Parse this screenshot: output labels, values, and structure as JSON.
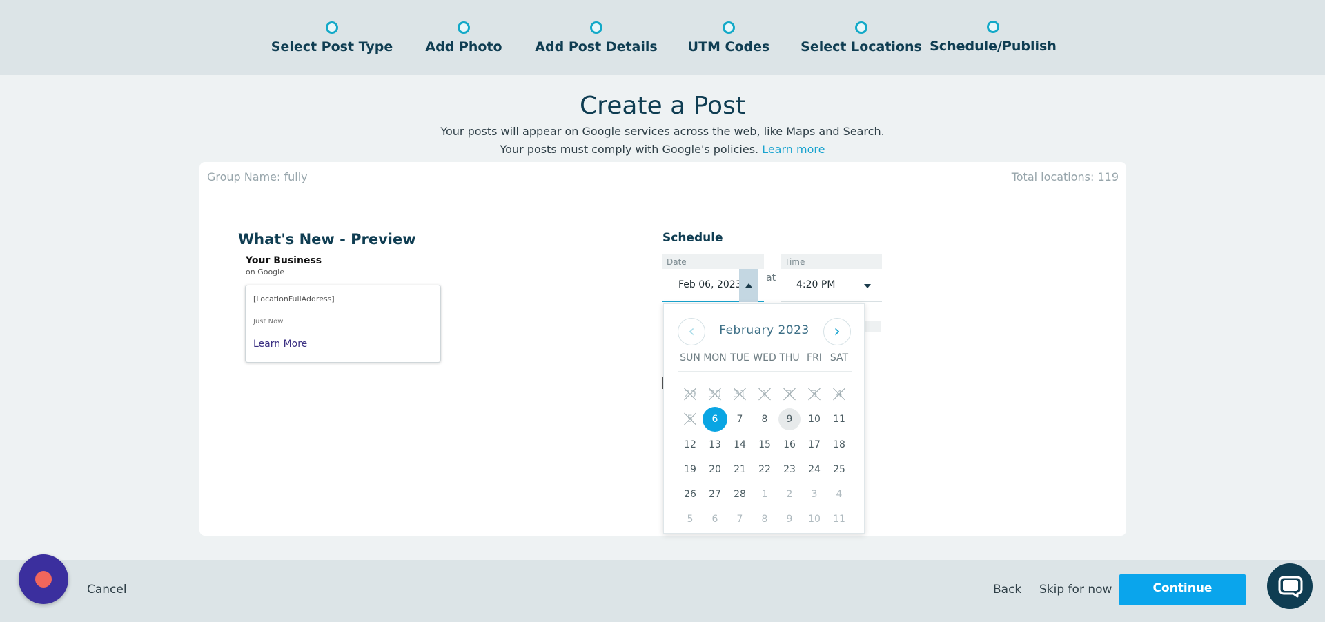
{
  "stepper": {
    "steps": [
      {
        "label": "Select Post Type"
      },
      {
        "label": "Add Photo"
      },
      {
        "label": "Add Post Details"
      },
      {
        "label": "UTM Codes"
      },
      {
        "label": "Select Locations"
      },
      {
        "label": "Schedule/Publish"
      }
    ]
  },
  "header": {
    "title": "Create a Post",
    "line1": "Your posts will appear on Google services across the web, like Maps and Search.",
    "line2_prefix": "Your posts must comply with Google's policies. ",
    "line2_link": "Learn more"
  },
  "card": {
    "group_name": "Group Name: fully",
    "total_locations": "Total locations: 119"
  },
  "preview": {
    "title": "What's New - Preview",
    "business_name": "Your Business",
    "business_sub": "on Google",
    "address": "[LocationFullAddress]",
    "time": "Just Now",
    "cta": "Learn More"
  },
  "schedule": {
    "title": "Schedule",
    "date_label": "Date",
    "date_value": "Feb 06, 2023",
    "at_label": "at",
    "time_label": "Time",
    "time_value": "4:20  PM"
  },
  "calendar": {
    "month_title": "February 2023",
    "prev_glyph": "‹",
    "next_glyph": "›",
    "weekdays": [
      "SUN",
      "MON",
      "TUE",
      "WED",
      "THU",
      "FRI",
      "SAT"
    ],
    "weeks": [
      [
        "29",
        "30",
        "31",
        "1",
        "2",
        "3",
        "4"
      ],
      [
        "5",
        "6",
        "7",
        "8",
        "9",
        "10",
        "11"
      ],
      [
        "12",
        "13",
        "14",
        "15",
        "16",
        "17",
        "18"
      ],
      [
        "19",
        "20",
        "21",
        "22",
        "23",
        "24",
        "25"
      ],
      [
        "26",
        "27",
        "28",
        "1",
        "2",
        "3",
        "4"
      ],
      [
        "5",
        "6",
        "7",
        "8",
        "9",
        "10",
        "11"
      ]
    ]
  },
  "footer": {
    "cancel": "Cancel",
    "back": "Back",
    "skip": "Skip for now",
    "continue": "Continue"
  },
  "colors": {
    "accent": "#0aa5ec",
    "step_ring": "#13a9c8",
    "navy": "#0f3d52",
    "record_button": "#3b2f9e",
    "record_dot": "#f2665c"
  },
  "icons": {
    "chat": "chat-bubble-icon",
    "record": "record-icon",
    "caret_up": "caret-up-icon",
    "caret_down": "caret-down-icon"
  }
}
